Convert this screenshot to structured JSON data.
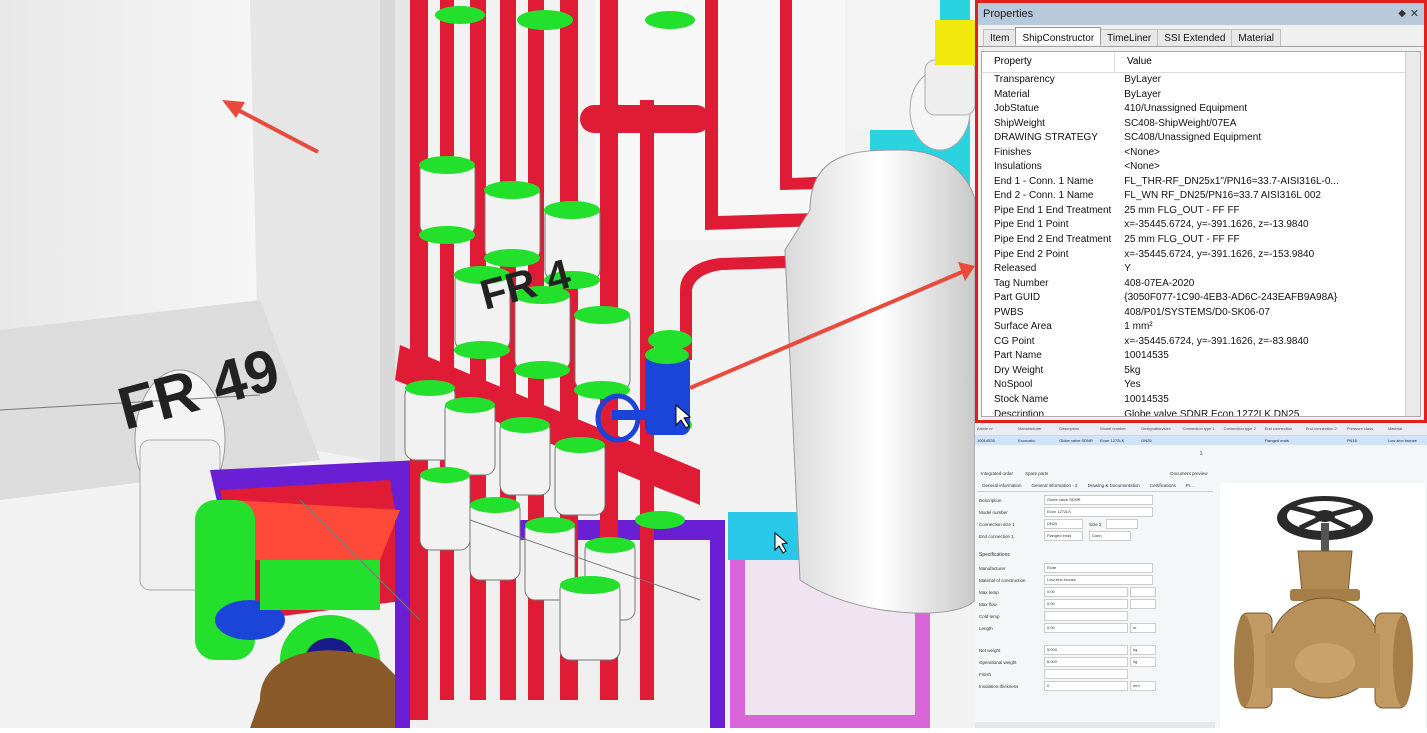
{
  "viewport": {
    "labels": {
      "frame_49": "FR 49",
      "frame_48": "FR 4"
    }
  },
  "properties": {
    "title": "Properties",
    "title_buttons": {
      "pin": "◆",
      "close": "✕"
    },
    "tabs": [
      "Item",
      "ShipConstructor",
      "TimeLiner",
      "SSI Extended",
      "Material"
    ],
    "active_tab": "ShipConstructor",
    "columns": {
      "property": "Property",
      "value": "Value"
    },
    "rows": [
      {
        "k": "Transparency",
        "v": "ByLayer"
      },
      {
        "k": "Material",
        "v": "ByLayer"
      },
      {
        "k": "JobStatue",
        "v": "410/Unassigned Equipment"
      },
      {
        "k": "ShipWeight",
        "v": "SC408-ShipWeight/07EA"
      },
      {
        "k": "DRAWING STRATEGY",
        "v": "SC408/Unassigned Equipment"
      },
      {
        "k": "Finishes",
        "v": "<None>"
      },
      {
        "k": "Insulations",
        "v": "<None>"
      },
      {
        "k": "End 1 - Conn. 1 Name",
        "v": "FL_THR-RF_DN25x1\"/PN16=33.7-AISI316L-0..."
      },
      {
        "k": "End 2 - Conn. 1 Name",
        "v": "FL_WN RF_DN25/PN16=33.7 AISI316L 002"
      },
      {
        "k": "Pipe End 1 End Treatment",
        "v": "25 mm FLG_OUT - FF FF"
      },
      {
        "k": "Pipe End 1 Point",
        "v": "x=-35445.6724, y=-391.1626, z=-13.9840"
      },
      {
        "k": "Pipe End 2 End Treatment",
        "v": "25 mm FLG_OUT - FF FF"
      },
      {
        "k": "Pipe End 2 Point",
        "v": "x=-35445.6724, y=-391.1626, z=-153.9840"
      },
      {
        "k": "Released",
        "v": "Y"
      },
      {
        "k": "Tag Number",
        "v": "408-07EA-2020"
      },
      {
        "k": "Part GUID",
        "v": "{3050F077-1C90-4EB3-AD6C-243EAFB9A98A}"
      },
      {
        "k": "PWBS",
        "v": "408/P01/SYSTEMS/D0-SK06-07"
      },
      {
        "k": "Surface Area",
        "v": "1 mm²"
      },
      {
        "k": "CG Point",
        "v": "x=-35445.6724, y=-391.1626, z=-83.9840"
      },
      {
        "k": "Part Name",
        "v": "10014535"
      },
      {
        "k": "Dry Weight",
        "v": "5kg"
      },
      {
        "k": "NoSpool",
        "v": "Yes"
      },
      {
        "k": "Stock Name",
        "v": "10014535"
      },
      {
        "k": "Description",
        "v": "Globe valve SDNR Econ 1272LK DN25"
      }
    ]
  },
  "detail": {
    "header_columns": [
      "Article nr",
      "Manufacturer",
      "Description",
      "Model number",
      "Designation/size",
      "Connection type 1",
      "Connection type 2",
      "End connection",
      "End connection 2",
      "Pressure class",
      "Material"
    ],
    "selected_row": [
      "10014535",
      "Econosto",
      "Globe valve SDNR",
      "Econ 1272LK",
      "DN25",
      "",
      "",
      "Flanged ends",
      "",
      "PN16",
      "Low zinc bronze"
    ],
    "pager": "1",
    "subtabs": [
      "Integrated order",
      "Spare parts",
      "Document preview"
    ],
    "inner_tabs": [
      "General information",
      "General information - 2",
      "Drawing & Documentation",
      "Certifications",
      "Pr..."
    ],
    "form": {
      "description_label": "Description",
      "description_value": "Globe valve SDNR",
      "model_label": "Model number",
      "model_value": "Econ 1272LK",
      "conn1_label": "Connection size 1",
      "conn1_value": "DN25",
      "size2_label": "Size 2",
      "endconn_label": "End connection 1",
      "endconn_value": "Flanged ends",
      "endconn2_label": "Conn.",
      "spec_title": "Specifications",
      "manufacturer_label": "Manufacturer",
      "manufacturer_value": "Elote",
      "material_label": "Material of construction",
      "material_value": "Low zinc bronze",
      "maxtemp_label": "Max temp",
      "maxtemp_value": "0,00",
      "maxflow_label": "Max flow",
      "maxflow_value": "0,00",
      "coldtemp_label": "Cold temp",
      "coldtemp_value": "",
      "length_label": "Length",
      "length_value": "0,00",
      "length_unit": "m",
      "netweight_label": "Net weight",
      "netweight_value": "5,000",
      "netweight_unit": "kg",
      "operating_label": "Operational weight",
      "operating_value": "6,000",
      "operating_unit": "kg",
      "finish_label": "Finish",
      "finish_value": "",
      "insulation_label": "Insulation thickness",
      "insulation_value": "0",
      "insulation_unit": "mm"
    }
  },
  "colors": {
    "pipe_red": "#e01b35",
    "flange_green": "#22e02b",
    "highlight_red": "#e02020",
    "valve_blue": "#1a45d8",
    "panel_title": "#b9c9dc"
  }
}
